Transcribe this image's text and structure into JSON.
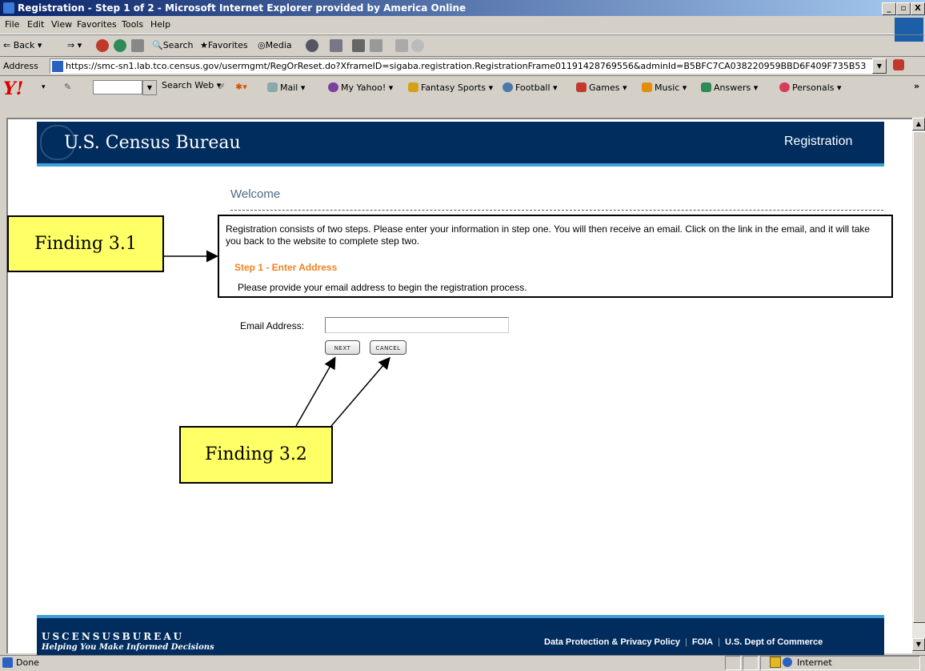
{
  "window": {
    "title": "Registration - Step 1 of 2 - Microsoft Internet Explorer provided by America Online",
    "controls": [
      "_",
      "▫",
      "X"
    ]
  },
  "menu": [
    "File",
    "Edit",
    "View",
    "Favorites",
    "Tools",
    "Help"
  ],
  "toolbar": {
    "back": "Back",
    "search": "Search",
    "favorites": "Favorites",
    "media": "Media"
  },
  "address": {
    "label": "Address",
    "url": "https://smc-sn1.lab.tco.census.gov/usermgmt/RegOrReset.do?XframeID=sigaba.registration.RegistrationFrame01191428769556&adminId=B5BFC7CA038220959BBD6F409F735B53"
  },
  "yahoo_toolbar": {
    "logo": "Y!",
    "search_button": "Search Web",
    "links": [
      "Mail",
      "My Yahoo!",
      "Fantasy Sports",
      "Football",
      "Games",
      "Music",
      "Answers",
      "Personals"
    ]
  },
  "census": {
    "name": "U.S. Census Bureau",
    "section": "Registration"
  },
  "content": {
    "heading": "Welcome",
    "intro": "Registration consists of two steps. Please enter your information in step one. You will then receive an email. Click on the link in the email, and it will take you back to the website to complete step two.",
    "step_title": "Step 1 - Enter Address",
    "step_desc": "Please provide your email address to begin the registration process.",
    "email_label": "Email Address:",
    "email_value": "",
    "next_label": "NEXT",
    "cancel_label": "CANCEL"
  },
  "callouts": {
    "finding_1": "Finding 3.1",
    "finding_2": "Finding 3.2"
  },
  "footer": {
    "brand": "USCENSUSBUREAU",
    "tagline": "Helping You Make Informed Decisions",
    "links": [
      "Data Protection & Privacy Policy",
      "FOIA",
      "U.S. Dept of Commerce"
    ]
  },
  "status": {
    "text": "Done",
    "zone": "Internet"
  }
}
